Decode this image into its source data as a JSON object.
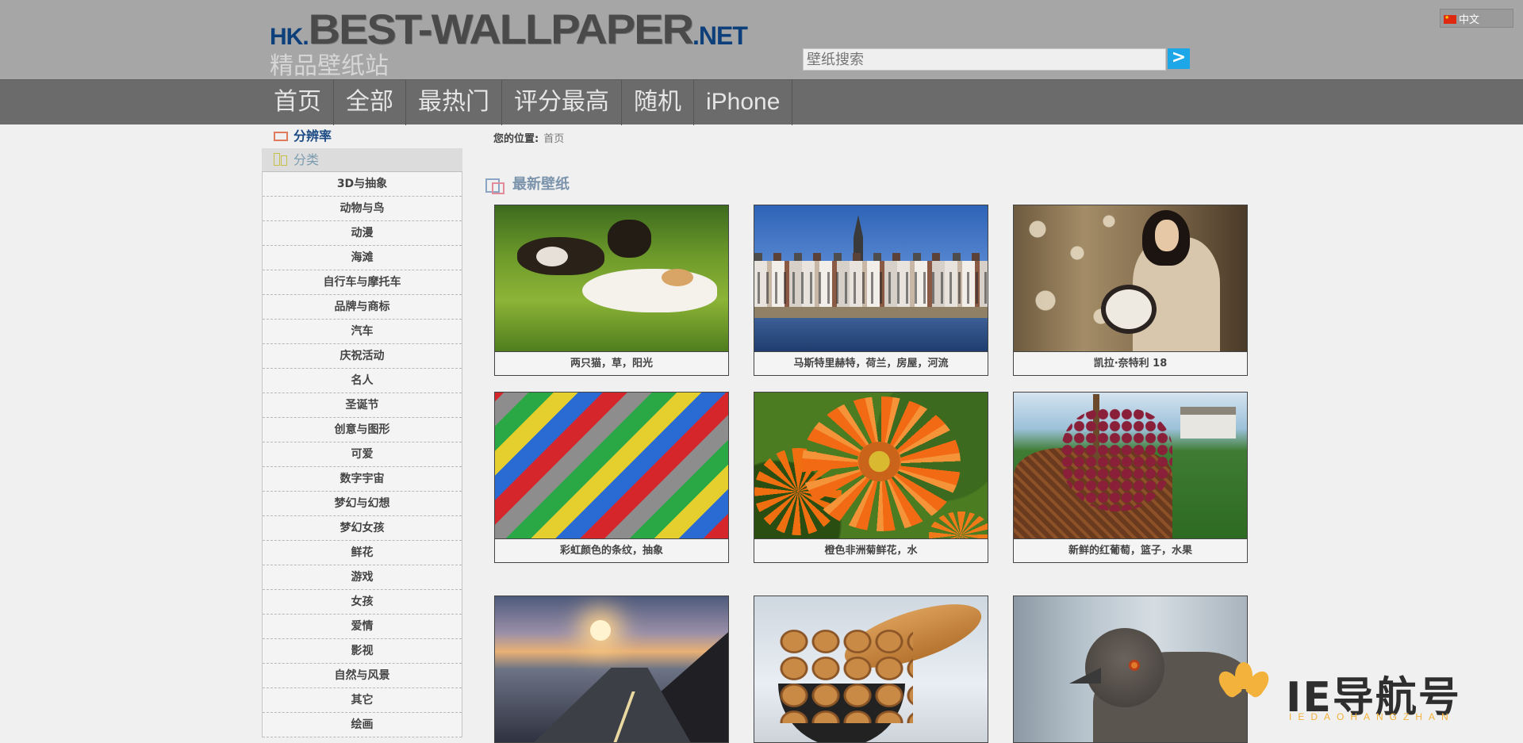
{
  "header": {
    "logo": {
      "prefix": "HK.",
      "main": "BEST-WALLPAPER",
      "suffix": ".NET"
    },
    "subtitle": "精品壁纸站",
    "search": {
      "placeholder": "壁纸搜索",
      "button": ">"
    },
    "language": {
      "label": "中文",
      "flag": "china-flag-icon"
    }
  },
  "nav": {
    "items": [
      "首页",
      "全部",
      "最热门",
      "评分最高",
      "随机",
      "iPhone"
    ]
  },
  "sidebar": {
    "resolution_heading": "分辨率",
    "category_heading": "分类",
    "categories": [
      "3D与抽象",
      "动物与鸟",
      "动漫",
      "海滩",
      "自行车与摩托车",
      "品牌与商标",
      "汽车",
      "庆祝活动",
      "名人",
      "圣诞节",
      "创意与图形",
      "可爱",
      "数字宇宙",
      "梦幻与幻想",
      "梦幻女孩",
      "鲜花",
      "游戏",
      "女孩",
      "爱情",
      "影视",
      "自然与风景",
      "其它",
      "绘画"
    ]
  },
  "main": {
    "breadcrumb": {
      "label": "您的位置:",
      "current": "首页"
    },
    "section_title": "最新壁纸",
    "wallpapers": [
      {
        "caption": "两只猫，草，阳光",
        "thumb": "cats"
      },
      {
        "caption": "马斯特里赫特，荷兰，房屋，河流",
        "thumb": "city"
      },
      {
        "caption": "凯拉·奈特利 18",
        "thumb": "woman"
      },
      {
        "caption": "彩虹颜色的条纹，抽象",
        "thumb": "stripes"
      },
      {
        "caption": "橙色非洲菊鲜花，水",
        "thumb": "flower"
      },
      {
        "caption": "新鲜的红葡萄，篮子，水果",
        "thumb": "grapes"
      },
      {
        "caption": "",
        "thumb": "road"
      },
      {
        "caption": "",
        "thumb": "bread"
      },
      {
        "caption": "",
        "thumb": "bird"
      }
    ]
  },
  "watermark": {
    "text": "IE导航号",
    "sub": "IEDAOHANGZHAN"
  },
  "colors": {
    "header_bg": "#a6a6a6",
    "nav_bg": "#6b6b6b",
    "accent": "#1ea7e8",
    "logo_blue": "#0d3f7a"
  }
}
